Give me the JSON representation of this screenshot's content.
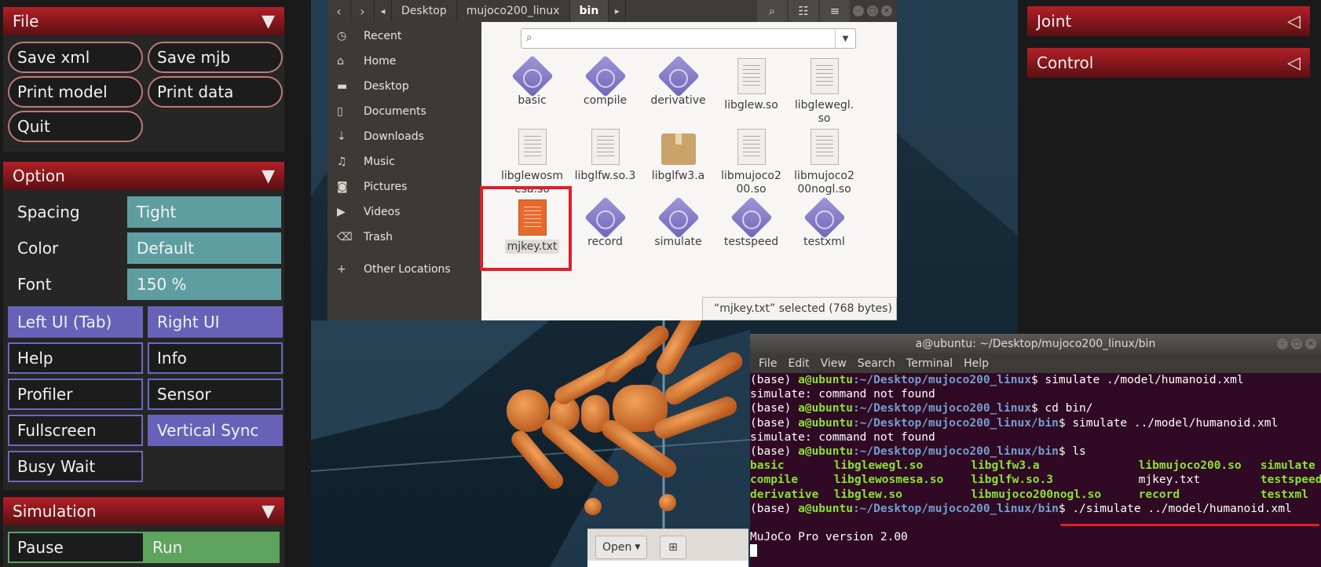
{
  "left_panel": {
    "file": {
      "title": "File",
      "buttons": [
        "Save xml",
        "Save mjb",
        "Print model",
        "Print data",
        "Quit"
      ]
    },
    "option": {
      "title": "Option",
      "rows": [
        {
          "label": "Spacing",
          "value": "Tight"
        },
        {
          "label": "Color",
          "value": "Default"
        },
        {
          "label": "Font",
          "value": "150 %"
        }
      ],
      "checks": [
        {
          "label": "Left UI (Tab)",
          "on": true
        },
        {
          "label": "Right UI",
          "on": true
        },
        {
          "label": "Help",
          "on": false
        },
        {
          "label": "Info",
          "on": false
        },
        {
          "label": "Profiler",
          "on": false
        },
        {
          "label": "Sensor",
          "on": false
        },
        {
          "label": "Fullscreen",
          "on": false
        },
        {
          "label": "Vertical Sync",
          "on": true
        },
        {
          "label": "Busy Wait",
          "on": false
        }
      ]
    },
    "simulation": {
      "title": "Simulation",
      "radio": [
        {
          "label": "Pause",
          "on": false
        },
        {
          "label": "Run",
          "on": true
        }
      ]
    }
  },
  "right_panel": {
    "joint": "Joint",
    "control": "Control"
  },
  "file_manager": {
    "breadcrumbs": [
      "Desktop",
      "mujoco200_linux",
      "bin"
    ],
    "sidebar": [
      {
        "label": "Recent",
        "icon": "clock-icon"
      },
      {
        "label": "Home",
        "icon": "home-icon"
      },
      {
        "label": "Desktop",
        "icon": "folder-icon"
      },
      {
        "label": "Documents",
        "icon": "document-icon"
      },
      {
        "label": "Downloads",
        "icon": "download-icon"
      },
      {
        "label": "Music",
        "icon": "music-icon"
      },
      {
        "label": "Pictures",
        "icon": "camera-icon"
      },
      {
        "label": "Videos",
        "icon": "video-icon"
      },
      {
        "label": "Trash",
        "icon": "trash-icon"
      },
      {
        "label": "Other Locations",
        "icon": "plus-icon"
      }
    ],
    "files": [
      {
        "name": "basic",
        "type": "exe"
      },
      {
        "name": "compile",
        "type": "exe"
      },
      {
        "name": "derivative",
        "type": "exe"
      },
      {
        "name": "libglew.so",
        "type": "doc"
      },
      {
        "name": "libglewegl.\nso",
        "type": "doc"
      },
      {
        "name": "libglewosm\nesa.so",
        "type": "doc"
      },
      {
        "name": "libglfw.so.3",
        "type": "doc"
      },
      {
        "name": "libglfw3.a",
        "type": "box"
      },
      {
        "name": "libmujoco2\n00.so",
        "type": "doc"
      },
      {
        "name": "libmujoco2\n00nogl.so",
        "type": "doc"
      },
      {
        "name": "mjkey.txt",
        "type": "txt",
        "selected": true
      },
      {
        "name": "record",
        "type": "exe"
      },
      {
        "name": "simulate",
        "type": "exe"
      },
      {
        "name": "testspeed",
        "type": "exe"
      },
      {
        "name": "testxml",
        "type": "exe"
      }
    ],
    "status": "“mjkey.txt” selected  (768 bytes)"
  },
  "terminal": {
    "title": "a@ubuntu: ~/Desktop/mujoco200_linux/bin",
    "menu": [
      "File",
      "Edit",
      "View",
      "Search",
      "Terminal",
      "Help"
    ],
    "lines": [
      {
        "env": "(base) ",
        "user": "a@ubuntu",
        "path": ":~/Desktop/mujoco200_linux",
        "cmd": "$ simulate ./model/humanoid.xml"
      },
      {
        "out": "simulate: command not found"
      },
      {
        "env": "(base) ",
        "user": "a@ubuntu",
        "path": ":~/Desktop/mujoco200_linux",
        "cmd": "$ cd bin/"
      },
      {
        "env": "(base) ",
        "user": "a@ubuntu",
        "path": ":~/Desktop/mujoco200_linux/bin",
        "cmd": "$ simulate ../model/humanoid.xml"
      },
      {
        "out": "simulate: command not found"
      },
      {
        "env": "(base) ",
        "user": "a@ubuntu",
        "path": ":~/Desktop/mujoco200_linux/bin",
        "cmd": "$ ls"
      },
      {
        "ls": [
          [
            "basic",
            true
          ],
          [
            "libglewegl.so",
            true
          ],
          [
            "libglfw3.a",
            true
          ],
          [
            "libmujoco200.so",
            true
          ],
          [
            "simulate",
            true
          ]
        ]
      },
      {
        "ls": [
          [
            "compile",
            true
          ],
          [
            "libglewosmesa.so",
            true
          ],
          [
            "libglfw.so.3",
            true
          ],
          [
            "mjkey.txt",
            false
          ],
          [
            "testspeed",
            true
          ]
        ]
      },
      {
        "ls": [
          [
            "derivative",
            true
          ],
          [
            "libglew.so",
            true
          ],
          [
            "libmujoco200nogl.so",
            true
          ],
          [
            "record",
            true
          ],
          [
            "testxml",
            true
          ]
        ]
      },
      {
        "env": "(base) ",
        "user": "a@ubuntu",
        "path": ":~/Desktop/mujoco200_linux/bin",
        "cmd": "$ ./simulate ../model/humanoid.xml"
      },
      {
        "out": ""
      },
      {
        "out": "MuJoCo Pro version 2.00"
      }
    ]
  },
  "open_bar": {
    "open_label": "Open",
    "pin_icon": "pin-icon"
  },
  "colors": {
    "highlight_box": "#e01e2a",
    "terminal_bg": "#300a24",
    "panel_header": "#b21f26"
  }
}
